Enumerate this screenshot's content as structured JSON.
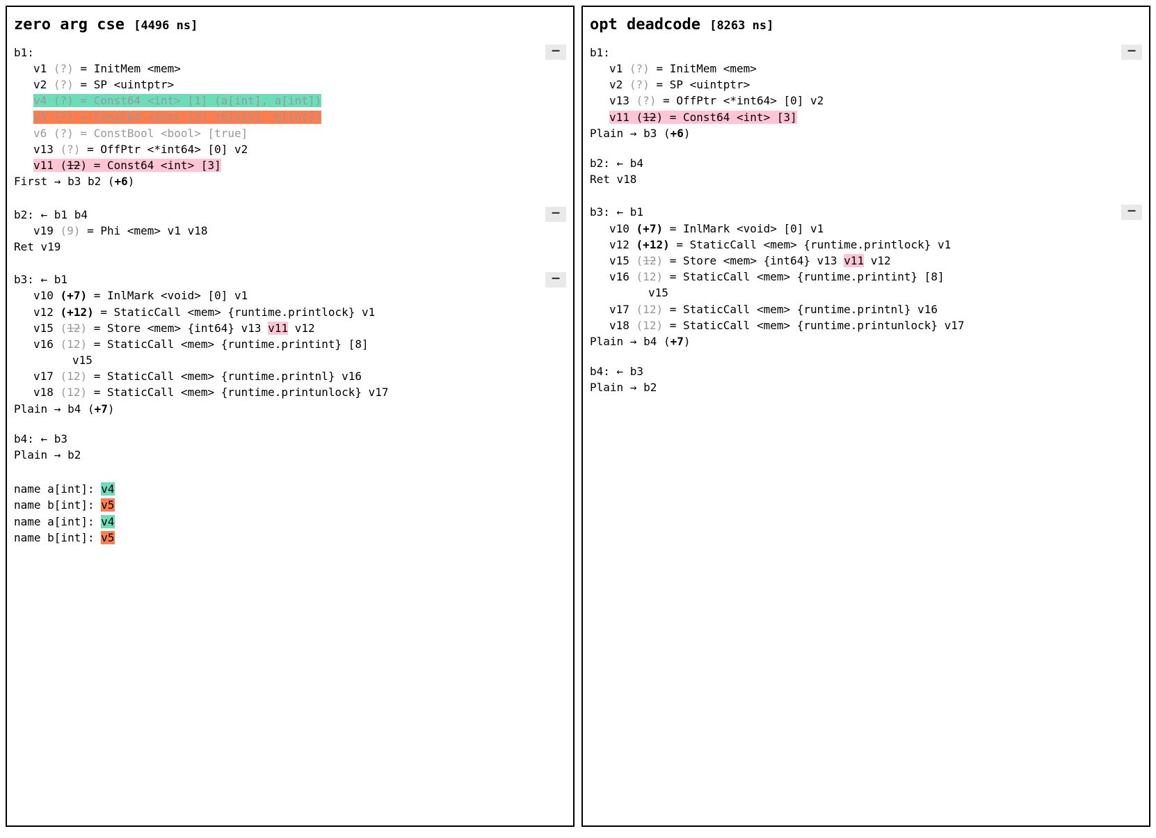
{
  "left": {
    "title": "zero arg cse",
    "ns": "[4496 ns]",
    "collapse": "–",
    "b1": {
      "label": "b1:",
      "v1": {
        "name": "v1",
        "paren": "(?)",
        "rest": " = InitMem <mem>"
      },
      "v2": {
        "name": "v2",
        "paren": "(?)",
        "rest": " = SP <uintptr>"
      },
      "v4": "v4 (?) = Const64 <int> [1] (a[int], a[int])",
      "v5": "v5 (?) = Const64 <int> [2] (b[int], b[int])",
      "v6": "v6 (?) = ConstBool <bool> [true]",
      "v13": {
        "name": "v13",
        "paren": "(?)",
        "rest": " = OffPtr <*int64> [0] v2"
      },
      "v11": {
        "pre": "v11 (",
        "strike": "12",
        "post": ") = Const64 <int> [3]"
      },
      "exit": {
        "pre": "First → b3 b2 (",
        "bold": "+6",
        "post": ")"
      }
    },
    "b2": {
      "label": "b2: ← b1 b4",
      "v19": {
        "name": "v19",
        "paren": "(9)",
        "rest": " = Phi <mem> v1 v18"
      },
      "exit": "Ret v19"
    },
    "b3": {
      "label": "b3: ← b1",
      "v10": {
        "name": "v10",
        "paren_bold": "(+7)",
        "rest": " = InlMark <void> [0] v1"
      },
      "v12": {
        "name": "v12",
        "paren_bold": "(+12)",
        "rest": " = StaticCall <mem> {runtime.printlock} v1"
      },
      "v15": {
        "name": "v15",
        "pre_paren": "(",
        "strike": "12",
        "post_paren": ")",
        "rest_a": " = Store <mem> {int64} v13 ",
        "hl": "v11",
        "rest_b": " v12"
      },
      "v16": {
        "name": "v16",
        "paren": "(12)",
        "rest": " = StaticCall <mem> {runtime.printint} [8]"
      },
      "v16_cont": "v15",
      "v17": {
        "name": "v17",
        "paren": "(12)",
        "rest": " = StaticCall <mem> {runtime.printnl} v16"
      },
      "v18": {
        "name": "v18",
        "paren": "(12)",
        "rest": " = StaticCall <mem> {runtime.printunlock} v17"
      },
      "exit": {
        "pre": "Plain → b4 (",
        "bold": "+7",
        "post": ")"
      }
    },
    "b4": {
      "label": "b4: ← b3",
      "exit": "Plain → b2"
    },
    "names": [
      {
        "label": "name a[int]: ",
        "val": "v4",
        "cls": "hl-green"
      },
      {
        "label": "name b[int]: ",
        "val": "v5",
        "cls": "hl-orange"
      },
      {
        "label": "name a[int]: ",
        "val": "v4",
        "cls": "hl-green"
      },
      {
        "label": "name b[int]: ",
        "val": "v5",
        "cls": "hl-orange"
      }
    ]
  },
  "right": {
    "title": "opt deadcode",
    "ns": "[8263 ns]",
    "collapse": "–",
    "b1": {
      "label": "b1:",
      "v1": {
        "name": "v1",
        "paren": "(?)",
        "rest": " = InitMem <mem>"
      },
      "v2": {
        "name": "v2",
        "paren": "(?)",
        "rest": " = SP <uintptr>"
      },
      "v13": {
        "name": "v13",
        "paren": "(?)",
        "rest": " = OffPtr <*int64> [0] v2"
      },
      "v11": {
        "pre": "v11 (",
        "strike": "12",
        "post": ") = Const64 <int> [3]"
      },
      "exit": {
        "pre": "Plain → b3 (",
        "bold": "+6",
        "post": ")"
      }
    },
    "b2": {
      "label": "b2: ← b4",
      "exit": "Ret v18"
    },
    "b3": {
      "label": "b3: ← b1",
      "v10": {
        "name": "v10",
        "paren_bold": "(+7)",
        "rest": " = InlMark <void> [0] v1"
      },
      "v12": {
        "name": "v12",
        "paren_bold": "(+12)",
        "rest": " = StaticCall <mem> {runtime.printlock} v1"
      },
      "v15": {
        "name": "v15",
        "pre_paren": "(",
        "strike": "12",
        "post_paren": ")",
        "rest_a": " = Store <mem> {int64} v13 ",
        "hl": "v11",
        "rest_b": " v12"
      },
      "v16": {
        "name": "v16",
        "paren": "(12)",
        "rest": " = StaticCall <mem> {runtime.printint} [8]"
      },
      "v16_cont": "v15",
      "v17": {
        "name": "v17",
        "paren": "(12)",
        "rest": " = StaticCall <mem> {runtime.printnl} v16"
      },
      "v18": {
        "name": "v18",
        "paren": "(12)",
        "rest": " = StaticCall <mem> {runtime.printunlock} v17"
      },
      "exit": {
        "pre": "Plain → b4 (",
        "bold": "+7",
        "post": ")"
      }
    },
    "b4": {
      "label": "b4: ← b3",
      "exit": "Plain → b2"
    }
  }
}
